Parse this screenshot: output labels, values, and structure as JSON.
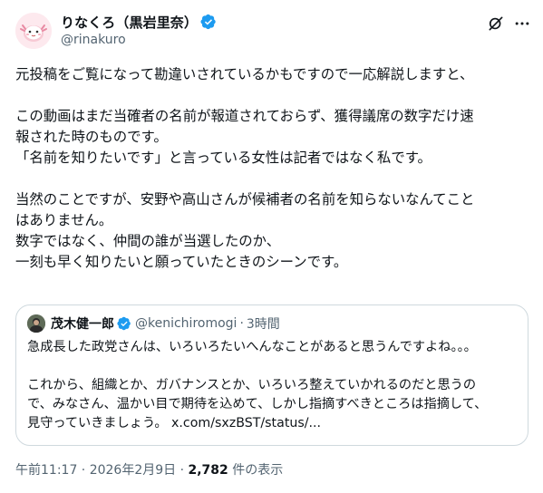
{
  "author": {
    "display_name": "りなくろ（黒岩里奈）",
    "handle": "@rinakuro",
    "verified_color": "#1d9bf0"
  },
  "post": {
    "lines": [
      "元投稿をご覧になって勘違いされているかもですので一応解説しますと、",
      "",
      "この動画はまだ当確者の名前が報道されておらず、獲得議席の数字だけ速",
      "報された時のものです。",
      "「名前を知りたいです」と言っている女性は記者ではなく私です。",
      "",
      "当然のことですが、安野や高山さんが候補者の名前を知らないなんてこと",
      "はありません。",
      "数字ではなく、仲間の誰が当選したのか、",
      "一刻も早く知りたいと願っていたときのシーンです。"
    ]
  },
  "quote": {
    "display_name": "茂木健一郎",
    "handle": "@kenichiromogi",
    "separator": "·",
    "time": "3時間",
    "lines": [
      "急成長した政党さんは、いろいろたいへんなことがあると思うんですよね。。。",
      "",
      "これから、組織とか、ガバナンスとか、いろいろ整えていかれるのだと思うの",
      "で、みなさん、温かい目で期待を込めて、しかし指摘すべきところは指摘して、",
      "見守っていきましょう。 x.com/sxzBST/status/..."
    ]
  },
  "meta": {
    "timestamp": "午前11:17 · 2026年2月9日 · ",
    "views_count": "2,782",
    "views_label": " 件の表示"
  },
  "icons": {
    "grok": "grok-icon",
    "more": "more-icon",
    "verified": "verified-badge-icon"
  }
}
